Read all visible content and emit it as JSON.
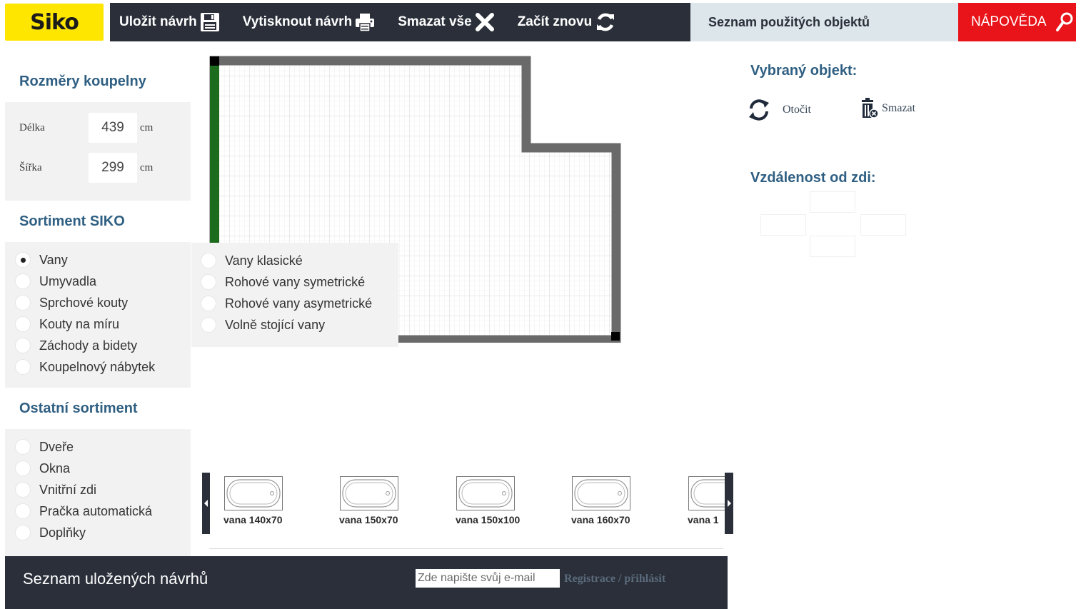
{
  "brand": {
    "logo_text": "Siko"
  },
  "toolbar": {
    "save_label": "Uložit návrh",
    "print_label": "Vytisknout návrh",
    "clear_label": "Smazat vše",
    "restart_label": "Začít znovu",
    "used_objects_label": "Seznam použitých objektů",
    "help_label": "NÁPOVĚDA"
  },
  "dimensions": {
    "title": "Rozměry koupelny",
    "length_label": "Délka",
    "length_value": "439",
    "width_label": "Šířka",
    "width_value": "299",
    "unit": "cm"
  },
  "assortment": {
    "title": "Sortiment SIKO",
    "items": [
      {
        "label": "Vany",
        "checked": true
      },
      {
        "label": "Umyvadla",
        "checked": false
      },
      {
        "label": "Sprchové kouty",
        "checked": false
      },
      {
        "label": "Kouty na míru",
        "checked": false
      },
      {
        "label": "Záchody a bidety",
        "checked": false
      },
      {
        "label": "Koupelnový nábytek",
        "checked": false
      }
    ]
  },
  "other": {
    "title": "Ostatní sortiment",
    "items": [
      {
        "label": "Dveře"
      },
      {
        "label": "Okna"
      },
      {
        "label": "Vnitřní zdi"
      },
      {
        "label": "Pračka automatická"
      },
      {
        "label": "Doplňky"
      }
    ]
  },
  "submenu": {
    "items": [
      {
        "label": "Vany klasické"
      },
      {
        "label": "Rohové vany symetrické"
      },
      {
        "label": "Rohové vany asymetrické"
      },
      {
        "label": "Volně stojící vany"
      }
    ]
  },
  "selected_object": {
    "title": "Vybraný objekt:",
    "rotate_label": "Otočit",
    "delete_label": "Smazat"
  },
  "wall_distance": {
    "title": "Vzdálenost od zdi:"
  },
  "carousel": {
    "items": [
      {
        "label": "vana 140x70"
      },
      {
        "label": "vana 150x70"
      },
      {
        "label": "vana 150x100"
      },
      {
        "label": "vana 160x70"
      },
      {
        "label": "vana 1"
      }
    ]
  },
  "footer": {
    "title": "Seznam uložených návrhů",
    "email_placeholder": "Zde napište svůj e-mail",
    "register_label": "Registrace / přihlásit"
  },
  "colors": {
    "topbar": "#2a2f3a",
    "logo_bg": "#ffe600",
    "help_bg": "#e8141a",
    "heading": "#2f5f82",
    "wall": "#6a6a6a",
    "selected_wall": "#1d6b1d"
  }
}
